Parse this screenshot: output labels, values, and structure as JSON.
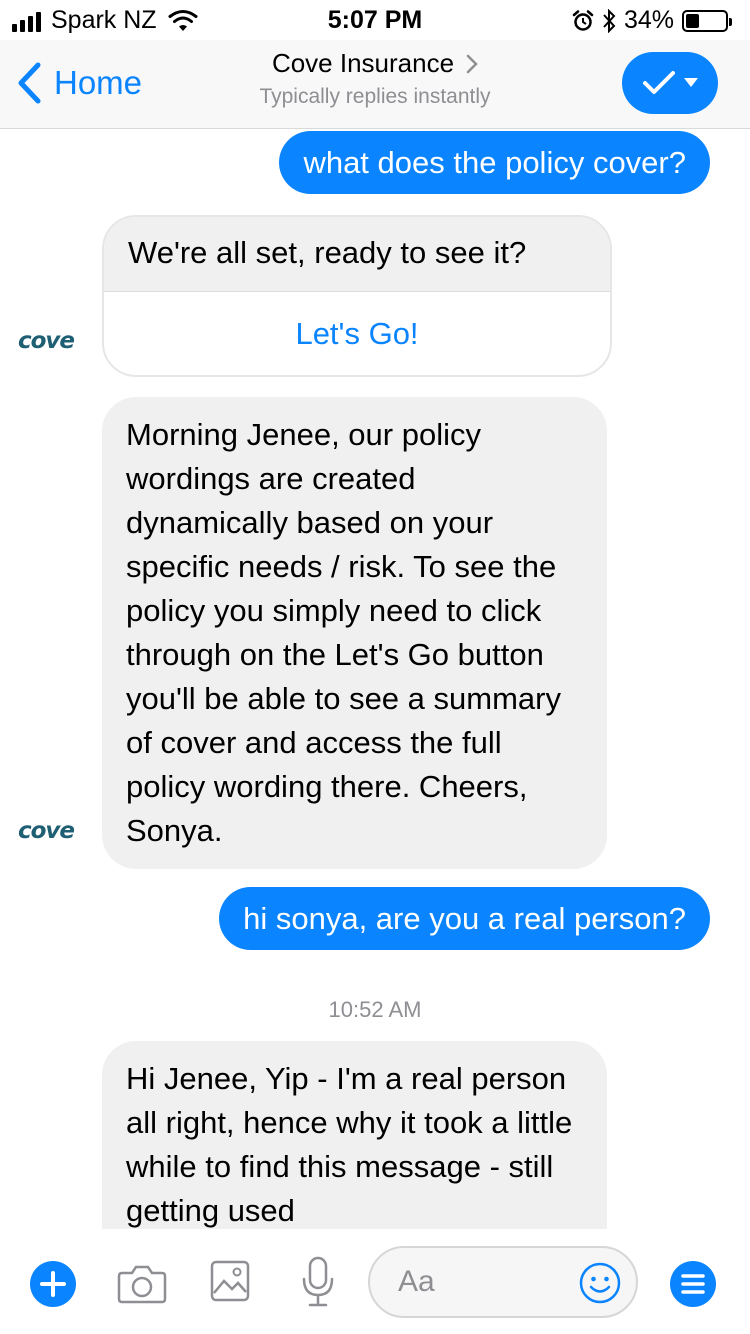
{
  "status_bar": {
    "carrier": "Spark NZ",
    "time": "5:07 PM",
    "battery": "34%",
    "battery_level": 0.34
  },
  "nav": {
    "back_label": "Home",
    "title": "Cove Insurance",
    "subtitle": "Typically replies instantly"
  },
  "messages": {
    "out_1": "what does the policy cover?",
    "card_text": "We're all set, ready to see it?",
    "card_button": "Let's Go!",
    "in_1": "Morning Jenee, our policy wordings are created dynamically based on your specific needs / risk.  To see the policy you simply need to click through on the Let's Go button you'll be able to see a summary of cover and access the full policy wording there. Cheers, Sonya.",
    "out_2": "hi sonya, are you a real person?",
    "timestamp": "10:52 AM",
    "in_2": "Hi Jenee,  Yip - I'm a real person all right, hence why it took a little while to find this message - still getting used"
  },
  "avatar_logo": "cove",
  "composer": {
    "placeholder": "Aa"
  },
  "colors": {
    "accent": "#0a84ff",
    "incoming_bubble": "#f0f0f0",
    "logo": "#1e5f74"
  },
  "icons": [
    "signal-icon",
    "wifi-icon",
    "alarm-icon",
    "bluetooth-icon",
    "battery-icon",
    "chevron-left-icon",
    "chevron-right-icon",
    "check-icon",
    "caret-down-icon",
    "plus-icon",
    "camera-icon",
    "image-icon",
    "microphone-icon",
    "emoji-icon",
    "menu-icon"
  ]
}
